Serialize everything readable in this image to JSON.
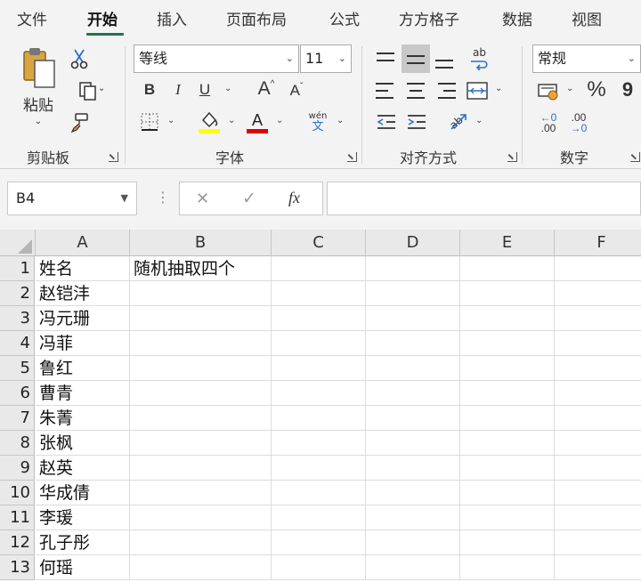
{
  "menu": {
    "tabs": [
      {
        "label": "文件"
      },
      {
        "label": "开始"
      },
      {
        "label": "插入"
      },
      {
        "label": "页面布局"
      },
      {
        "label": "公式"
      },
      {
        "label": "方方格子"
      },
      {
        "label": "数据"
      },
      {
        "label": "视图"
      }
    ],
    "active_tab": "开始"
  },
  "ribbon": {
    "clipboard": {
      "label": "剪贴板",
      "paste_label": "粘贴"
    },
    "font": {
      "label": "字体",
      "font_name": "等线",
      "font_size": "11",
      "bold": "B",
      "italic": "I",
      "underline": "U",
      "grow": "A",
      "shrink": "A",
      "phonetic_top": "wén",
      "phonetic_bottom": "文",
      "fill_color": "#ffff00",
      "font_color": "#e00000"
    },
    "alignment": {
      "label": "对齐方式"
    },
    "number": {
      "label": "数字",
      "format": "常规",
      "percent": "%",
      "dec_inc_top": "←0",
      "dec_inc_bottom": ".00",
      "dec_dec_top": ".00",
      "dec_dec_bottom": "→0"
    }
  },
  "formula_bar": {
    "name_box": "B4",
    "cancel": "✕",
    "enter": "✓",
    "fx": "fx",
    "formula": ""
  },
  "sheet": {
    "columns": [
      "A",
      "B",
      "C",
      "D",
      "E",
      "F"
    ],
    "rows": [
      {
        "num": "1",
        "A": "姓名",
        "B": "随机抽取四个"
      },
      {
        "num": "2",
        "A": "赵铠沣",
        "B": ""
      },
      {
        "num": "3",
        "A": "冯元珊",
        "B": ""
      },
      {
        "num": "4",
        "A": "冯菲",
        "B": ""
      },
      {
        "num": "5",
        "A": "鲁红",
        "B": ""
      },
      {
        "num": "6",
        "A": "曹青",
        "B": ""
      },
      {
        "num": "7",
        "A": "朱菁",
        "B": ""
      },
      {
        "num": "8",
        "A": "张枫",
        "B": ""
      },
      {
        "num": "9",
        "A": "赵英",
        "B": ""
      },
      {
        "num": "10",
        "A": "华成倩",
        "B": ""
      },
      {
        "num": "11",
        "A": "李瑗",
        "B": ""
      },
      {
        "num": "12",
        "A": "孔子彤",
        "B": ""
      },
      {
        "num": "13",
        "A": "何瑶",
        "B": ""
      }
    ],
    "selected_cell": "B4",
    "accent_color": "#217346"
  }
}
